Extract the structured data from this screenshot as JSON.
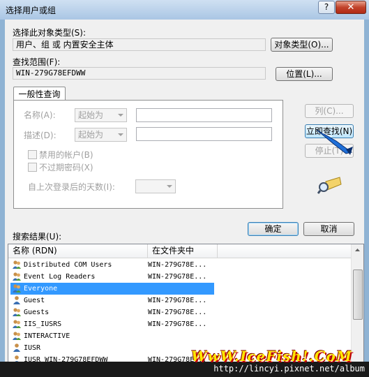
{
  "window": {
    "title": "选择用户或组",
    "help_label": "?",
    "close_label": "✕"
  },
  "object_types": {
    "label": "选择此对象类型(S):",
    "value": "用户、组 或 内置安全主体",
    "button": "对象类型(O)..."
  },
  "location": {
    "label": "查找范围(F):",
    "value": "WIN-279G78EFDWW",
    "button": "位置(L)..."
  },
  "query_tab": {
    "tab_label": "一般性查询",
    "name_label": "名称(A):",
    "name_mode": "起始为",
    "desc_label": "描述(D):",
    "desc_mode": "起始为",
    "disabled_accounts": "禁用的帐户(B)",
    "no_expire_pw": "不过期密码(X)",
    "days_since_logon": "自上次登录后的天数(I):"
  },
  "actions": {
    "columns": "列(C)...",
    "find_now": "立即查找(N)",
    "stop": "停止(T)",
    "ok": "确定",
    "cancel": "取消"
  },
  "results": {
    "label": "搜索结果(U):",
    "columns": [
      "名称 (RDN)",
      "在文件夹中"
    ],
    "rows": [
      {
        "name": "Distributed COM Users",
        "folder": "WIN-279G78E...",
        "icon": "group-icon"
      },
      {
        "name": "Event Log Readers",
        "folder": "WIN-279G78E...",
        "icon": "group-icon"
      },
      {
        "name": "Everyone",
        "folder": "",
        "icon": "group-icon",
        "selected": true
      },
      {
        "name": "Guest",
        "folder": "WIN-279G78E...",
        "icon": "user-icon"
      },
      {
        "name": "Guests",
        "folder": "WIN-279G78E...",
        "icon": "group-icon"
      },
      {
        "name": "IIS_IUSRS",
        "folder": "WIN-279G78E...",
        "icon": "group-icon"
      },
      {
        "name": "INTERACTIVE",
        "folder": "",
        "icon": "group-icon"
      },
      {
        "name": "IUSR",
        "folder": "",
        "icon": "user-icon"
      },
      {
        "name": "IUSR_WIN-279G78EFDWW",
        "folder": "WIN-279G78E...",
        "icon": "user-icon"
      }
    ]
  },
  "watermark": {
    "text": "WwW.IceFish!.CoM",
    "url": "http://lincyi.pixnet.net/album"
  }
}
